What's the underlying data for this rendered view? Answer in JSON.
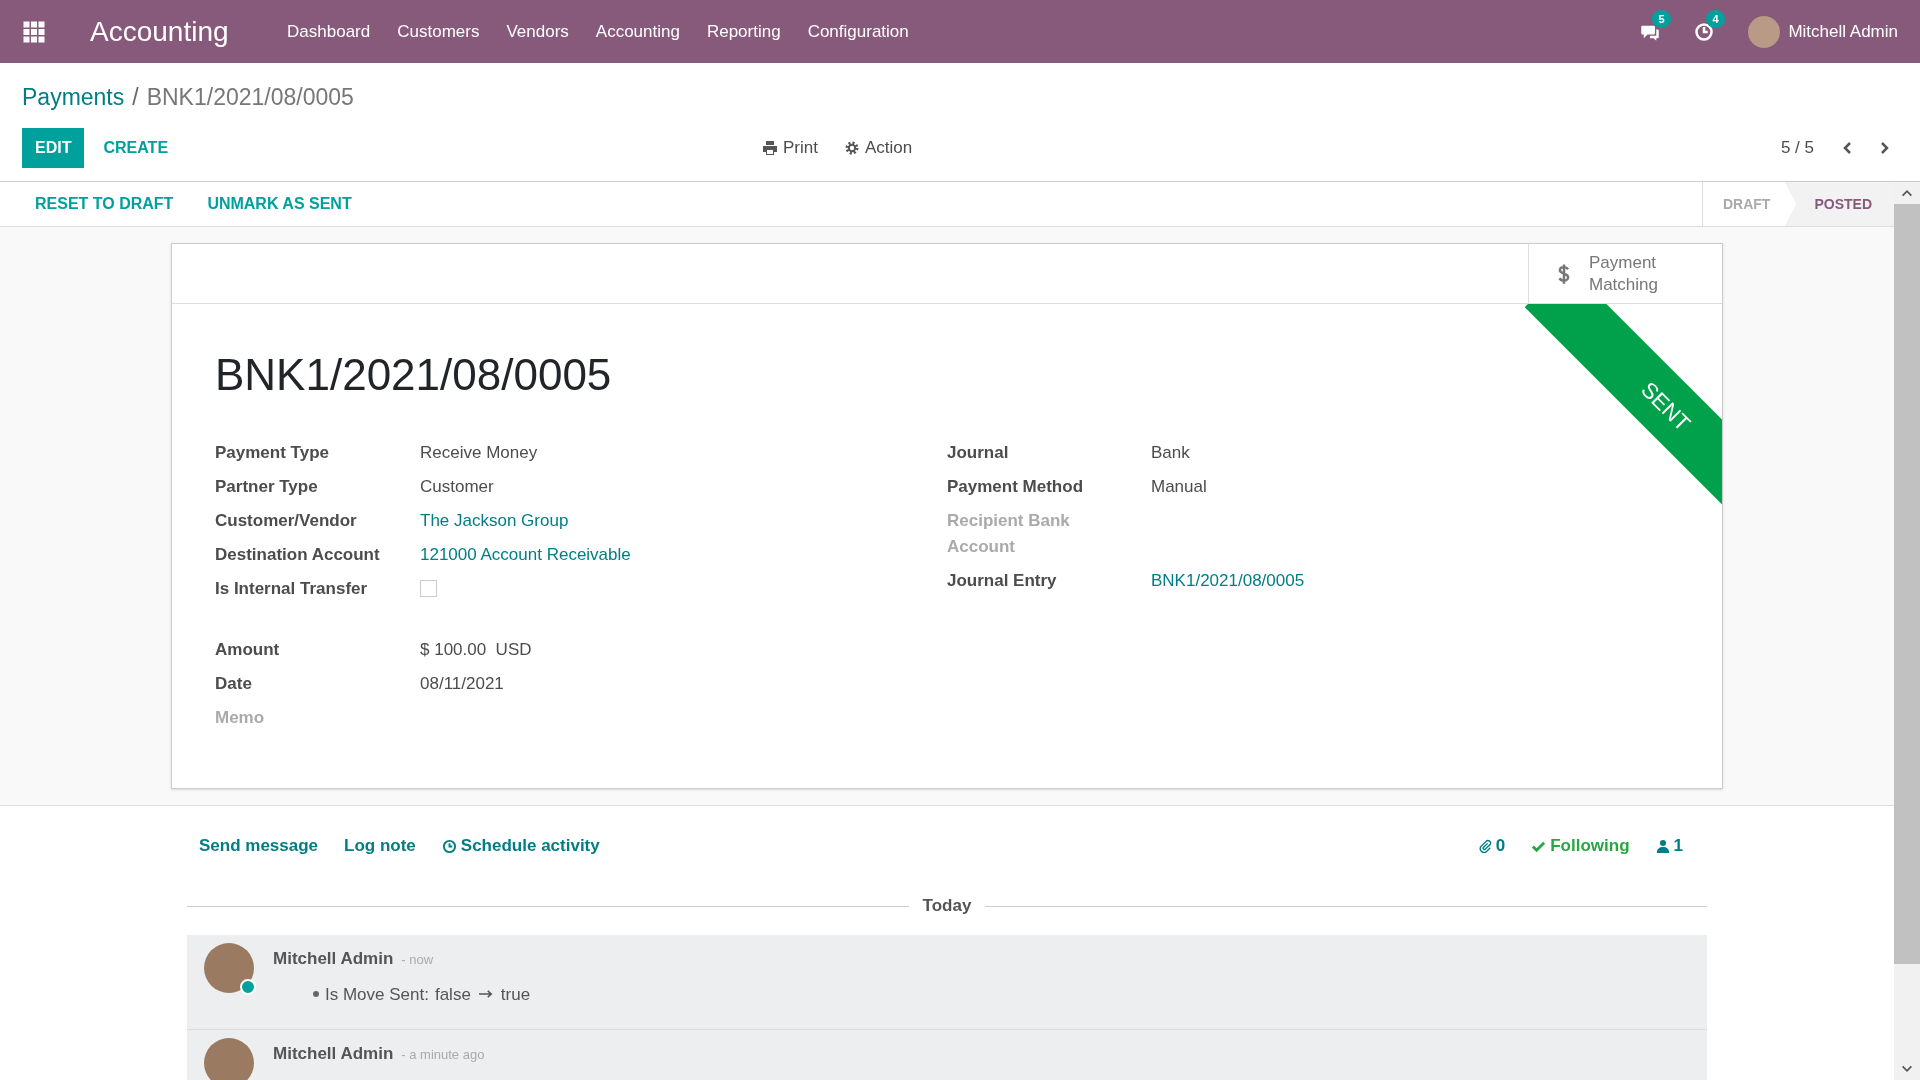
{
  "navbar": {
    "app": "Accounting",
    "menu": [
      "Dashboard",
      "Customers",
      "Vendors",
      "Accounting",
      "Reporting",
      "Configuration"
    ],
    "messages_count": "5",
    "activities_count": "4",
    "user": "Mitchell Admin"
  },
  "breadcrumb": [
    {
      "label": "Payments",
      "kind": "link"
    },
    {
      "label": "/",
      "kind": "separator"
    },
    {
      "label": "BNK1/2021/08/0005",
      "kind": "current"
    }
  ],
  "control_panel": {
    "buttons": [
      {
        "label": "EDIT",
        "kind": "primary"
      },
      {
        "label": "CREATE",
        "kind": "link"
      }
    ],
    "print": "Print",
    "action": "Action",
    "pager": "5 / 5"
  },
  "statusbar": {
    "buttons": [
      "RESET TO DRAFT",
      "UNMARK AS SENT"
    ],
    "stages": [
      {
        "label": "DRAFT",
        "selected": false
      },
      {
        "label": "POSTED",
        "selected": true
      }
    ]
  },
  "sheet": {
    "smart_button": {
      "label": "Payment Matching"
    },
    "ribbon": "SENT",
    "title": "BNK1/2021/08/0005",
    "left_fields": [
      {
        "label": "Payment Type",
        "value": "Receive Money",
        "kind": "text",
        "muted": false
      },
      {
        "label": "Partner Type",
        "value": "Customer",
        "kind": "text",
        "muted": false
      },
      {
        "label": "Customer/Vendor",
        "value": "The Jackson Group",
        "kind": "link",
        "muted": false
      },
      {
        "label": "Destination Account",
        "value": "121000 Account Receivable",
        "kind": "link",
        "muted": false
      },
      {
        "label": "Is Internal Transfer",
        "kind": "checkbox",
        "checked": false,
        "muted": false
      },
      {
        "kind": "spacer"
      },
      {
        "label": "Amount",
        "value": "$ 100.00  USD",
        "kind": "text",
        "muted": false
      },
      {
        "label": "Date",
        "value": "08/11/2021",
        "kind": "text",
        "muted": false
      },
      {
        "label": "Memo",
        "kind": "empty",
        "muted": true
      }
    ],
    "right_fields": [
      {
        "label": "Journal",
        "value": "Bank",
        "kind": "text",
        "muted": false
      },
      {
        "label": "Payment Method",
        "value": "Manual",
        "kind": "text",
        "muted": false
      },
      {
        "label": "Recipient Bank Account",
        "kind": "empty",
        "muted": true
      },
      {
        "label": "Journal Entry",
        "value": "BNK1/2021/08/0005",
        "kind": "link",
        "muted": false
      }
    ]
  },
  "chatter": {
    "actions": [
      "Send message",
      "Log note",
      "Schedule activity"
    ],
    "attachments": "0",
    "following": "Following",
    "followers": "1",
    "separator": "Today",
    "messages": [
      {
        "author": "Mitchell Admin",
        "time": "- now",
        "online": true,
        "change": {
          "field": "Is Move Sent:",
          "old": "false",
          "new": "true"
        }
      },
      {
        "author": "Mitchell Admin",
        "time": "- a minute ago",
        "online": false
      }
    ]
  }
}
